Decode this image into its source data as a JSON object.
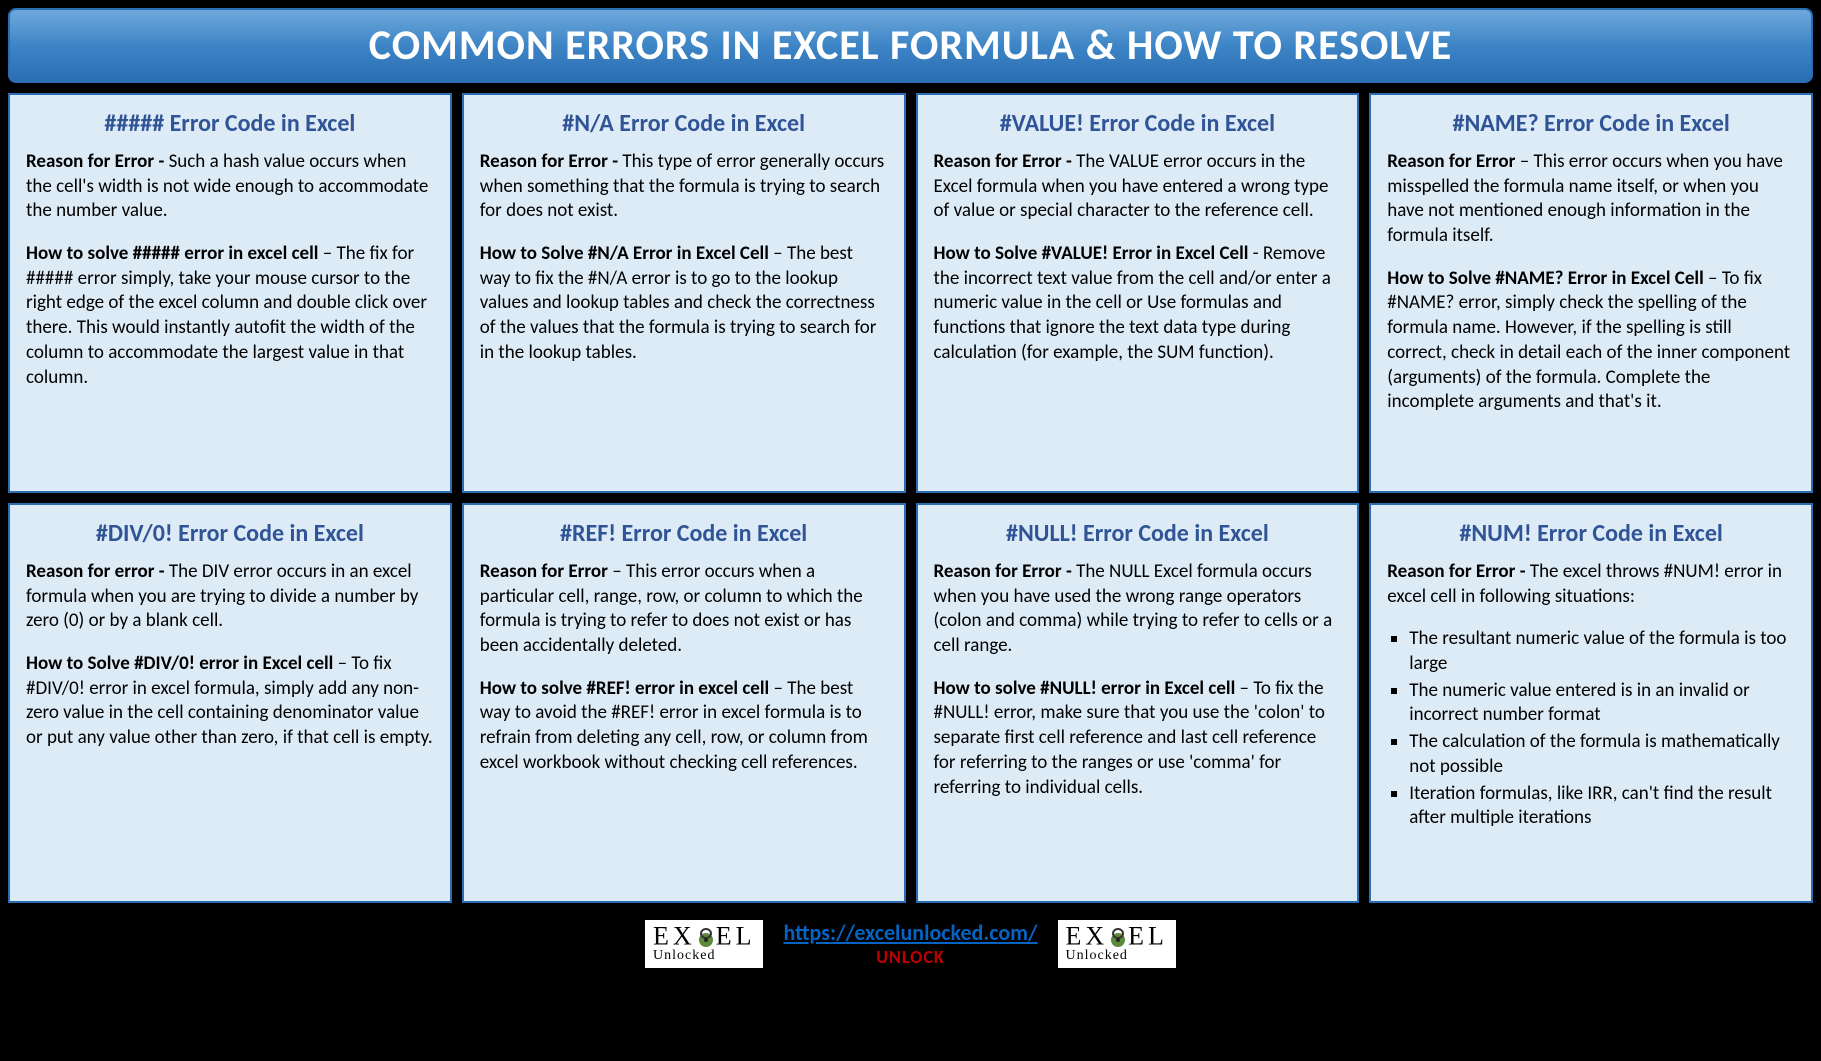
{
  "title": "COMMON ERRORS IN EXCEL FORMULA & HOW TO RESOLVE",
  "cards": [
    {
      "title": "##### Error Code in Excel",
      "reason_label": "Reason for Error - ",
      "reason_text": "Such a hash value occurs when the cell's width is not wide enough to accommodate the number value.",
      "solve_label": "How to solve ##### error in excel cell",
      "solve_sep": " – ",
      "solve_text": "The fix for ##### error simply, take your mouse cursor to the right edge of the excel column and double click over there. This would instantly autofit the width of the column to accommodate the largest value in that column."
    },
    {
      "title": "#N/A Error Code in Excel",
      "reason_label": "Reason for Error - ",
      "reason_text": "This type of error generally occurs when something that the formula is trying to search for does not exist.",
      "solve_label": "How to Solve #N/A Error in Excel Cell",
      "solve_sep": " – ",
      "solve_text": "The best way to fix the #N/A error is to go to the lookup values and lookup tables and check the correctness of the values that the formula is trying to search for in the lookup tables."
    },
    {
      "title": "#VALUE! Error Code in Excel",
      "reason_label": "Reason for Error - ",
      "reason_text": "The VALUE error occurs in the Excel formula when you have entered a wrong type of value or special character to the reference cell.",
      "solve_label": "How to Solve #VALUE! Error in Excel Cell",
      "solve_sep": " - ",
      "solve_text": "Remove the incorrect text value from the cell and/or enter a numeric value in the cell or Use formulas and functions that ignore the text data type during calculation (for example, the SUM function)."
    },
    {
      "title": "#NAME? Error Code in Excel",
      "reason_label": "Reason for Error",
      "reason_sep": " – ",
      "reason_text": "This error occurs when you have misspelled the formula name itself, or when you have not mentioned enough information in the formula itself.",
      "solve_label": "How to Solve #NAME? Error in Excel Cell",
      "solve_sep": " – ",
      "solve_text": "To fix #NAME? error, simply check the spelling of the formula name. However, if the spelling is still correct, check in detail each of the inner component (arguments) of the formula. Complete the incomplete arguments and that's it."
    },
    {
      "title": "#DIV/0! Error Code in Excel",
      "reason_label": "Reason for error - ",
      "reason_text": "The DIV error occurs in an excel formula when you are trying to divide a number by zero (0) or by a blank cell.",
      "solve_label": "How to Solve #DIV/0! error in Excel cell",
      "solve_sep": " – ",
      "solve_text": "To fix #DIV/0! error in excel formula, simply add any non-zero value in the cell containing denominator value or put any value other than zero, if that cell is empty."
    },
    {
      "title": "#REF! Error Code in Excel",
      "reason_label": "Reason for Error",
      "reason_sep": " – ",
      "reason_text": "This error occurs when a particular cell, range, row, or column to which the formula is trying to refer to does not exist or has been accidentally deleted.",
      "solve_label": "How to solve #REF! error in excel cell",
      "solve_sep": " – ",
      "solve_text": "The best way to avoid the #REF! error in excel formula is to refrain from deleting any cell, row, or column from excel workbook without checking cell references."
    },
    {
      "title": "#NULL! Error Code in Excel",
      "reason_label": "Reason for Error - ",
      "reason_text": "The NULL Excel formula occurs when you have used the wrong range operators (colon and comma) while trying to refer to cells or a cell range.",
      "solve_label": "How to solve #NULL! error in Excel cell",
      "solve_sep": " – ",
      "solve_text": "To fix the #NULL! error, make sure that you use the 'colon' to separate first cell reference and last cell reference for referring to the ranges or use 'comma' for referring to individual cells."
    },
    {
      "title": "#NUM! Error Code in Excel",
      "reason_label": "Reason for Error - ",
      "reason_text": "The excel throws #NUM! error in excel cell in following situations:",
      "bullets": [
        "The resultant numeric value of the formula is too large",
        "The numeric value entered is in an invalid or incorrect number format",
        "The calculation of the formula is mathematically not possible",
        "Iteration formulas, like IRR, can't find the result after multiple iterations"
      ]
    }
  ],
  "footer": {
    "url": "https://excelunlocked.com/",
    "tagline": "UNLOCK",
    "logo_main": "EXCEL",
    "logo_sub": "Unlocked"
  }
}
